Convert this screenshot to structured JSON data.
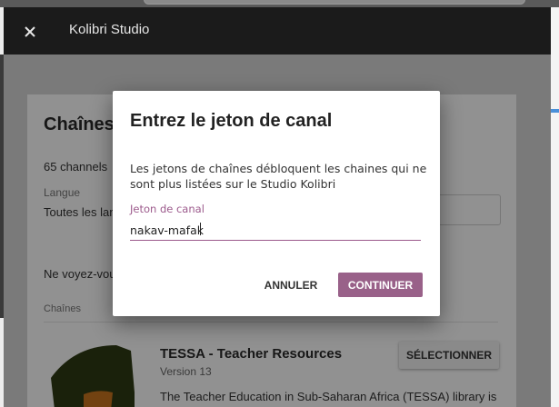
{
  "app": {
    "title": "Kolibri Studio"
  },
  "import_page": {
    "heading": "Chaînes",
    "channel_count": "65 channels",
    "language_label": "Langue",
    "language_value": "Toutes les lan",
    "not_found_text": "Ne voyez-vou",
    "section_label": "Chaînes"
  },
  "channel": {
    "title": "TESSA - Teacher Resources",
    "version": "Version 13",
    "description": "The Teacher Education in Sub-Saharan Africa (TESSA) library is",
    "select_label": "SÉLECTIONNER"
  },
  "dialog": {
    "title": "Entrez le jeton de canal",
    "description": "Les jetons de chaînes débloquent les chaines qui ne sont plus listées sur le Studio Kolibri",
    "input_label": "Jeton de canal",
    "input_value": "nakav-mafak",
    "cancel_label": "ANNULER",
    "continue_label": "CONTINUER"
  },
  "colors": {
    "accent": "#996189",
    "appbar": "#1b1b1b",
    "scrim": "rgba(0,0,0,0.43)"
  },
  "icons": {
    "close": "close-icon"
  }
}
